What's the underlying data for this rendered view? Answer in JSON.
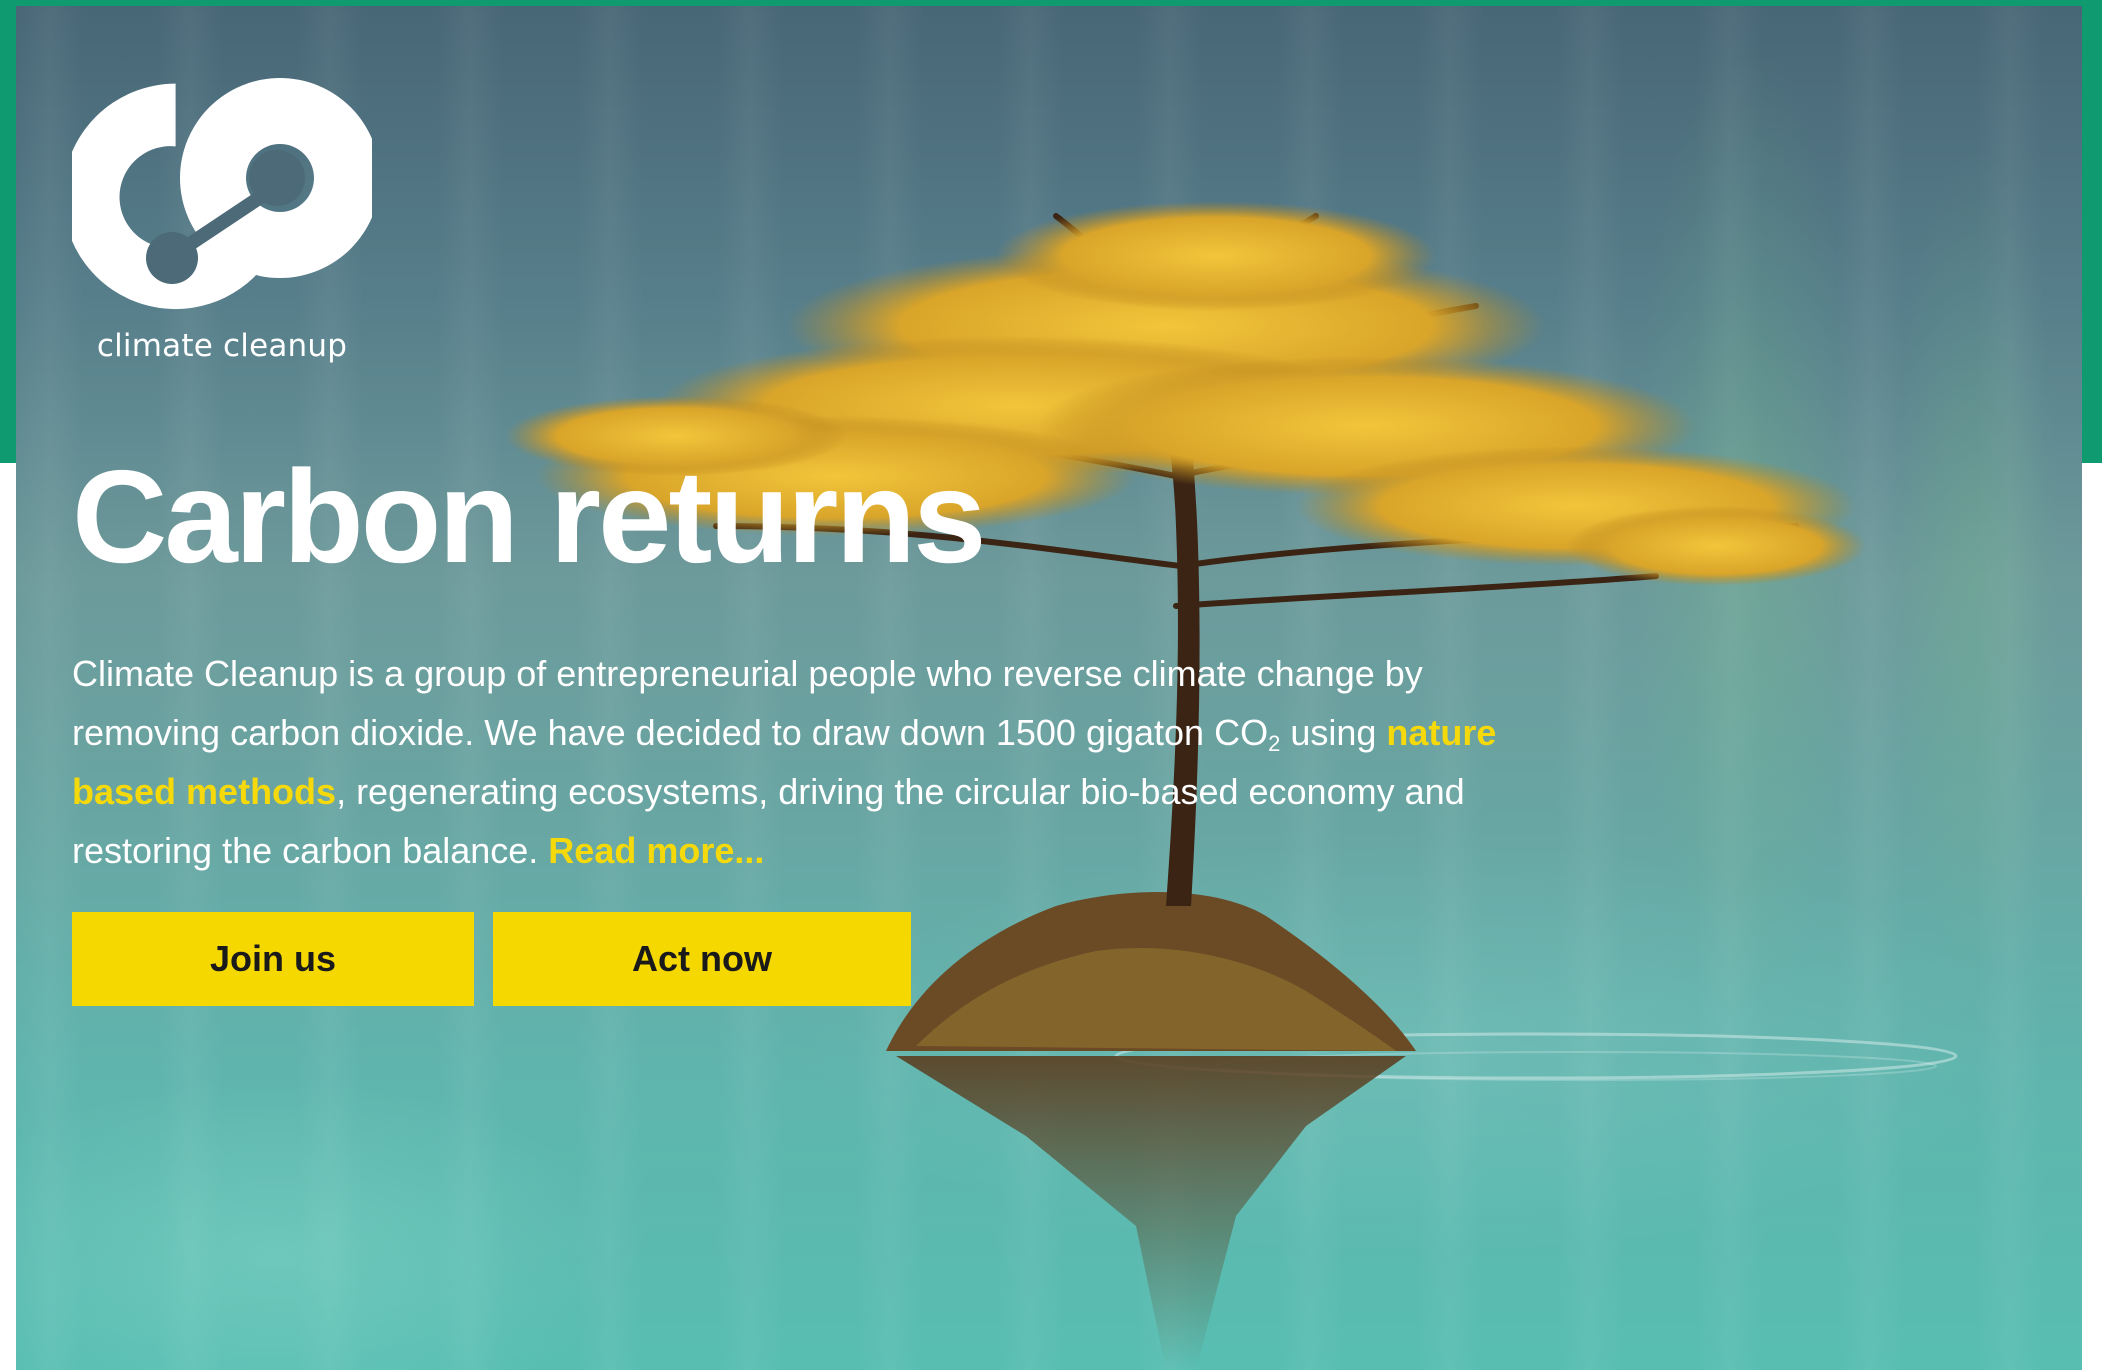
{
  "brand": {
    "name": "climate cleanup",
    "logo_icon": "co2-ring-icon"
  },
  "hero": {
    "headline": "Carbon returns",
    "intro": {
      "part1": "Climate Cleanup is a group of entrepreneurial people who reverse climate change by removing carbon dioxide. We have decided to draw down 1500 gigaton CO",
      "co2_subscript": "2",
      "part2": " using ",
      "link_nature": "nature based methods",
      "part3": ", regenerating ecosystems, driving the circular bio-based economy and restoring the carbon balance. ",
      "link_read_more": "Read more..."
    },
    "buttons": {
      "join_label": "Join us",
      "act_label": "Act now"
    },
    "background_image": "tree-on-island-in-lake"
  },
  "colors": {
    "accent_yellow": "#f5d800",
    "brand_green": "#0f9a70",
    "text_white": "#ffffff"
  }
}
